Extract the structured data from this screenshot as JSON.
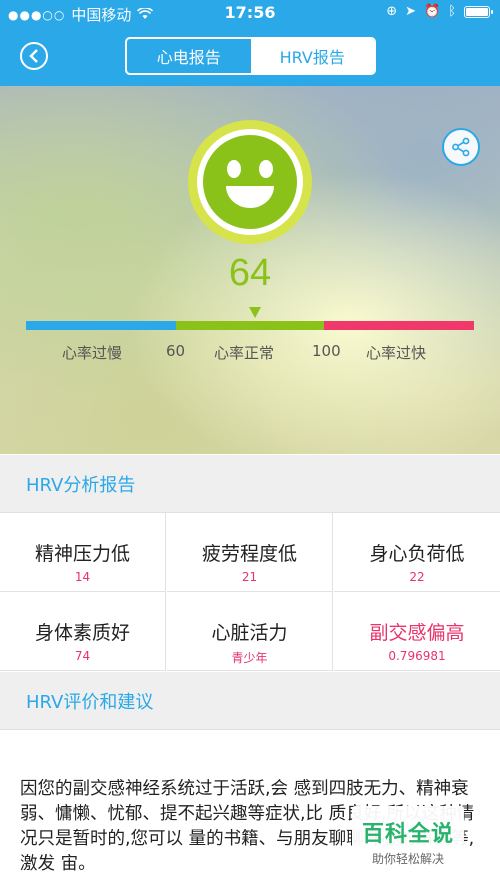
{
  "status_bar": {
    "carrier": "中国移动",
    "time": "17:56"
  },
  "nav": {
    "tabs": [
      {
        "label": "心电报告",
        "active": false
      },
      {
        "label": "HRV报告",
        "active": true
      }
    ]
  },
  "hero": {
    "score": "64",
    "range_labels": [
      "心率过慢",
      "60",
      "心率正常",
      "100",
      "心率过快"
    ],
    "colors": {
      "slow": "#2aa8e8",
      "normal": "#8bc21a",
      "fast": "#f0386a"
    }
  },
  "analysis": {
    "title": "HRV分析报告",
    "items": [
      {
        "label": "精神压力低",
        "value": "14"
      },
      {
        "label": "疲劳程度低",
        "value": "21"
      },
      {
        "label": "身心负荷低",
        "value": "22"
      },
      {
        "label": "身体素质好",
        "value": "74"
      },
      {
        "label": "心脏活力",
        "value": "青少年"
      },
      {
        "label": "副交感偏高",
        "value": "0.796981"
      }
    ]
  },
  "advice": {
    "title": "HRV评价和建议",
    "text": "因您的副交感神经系统过于活跃,会 感到四肢无力、精神衰弱、慵懒、忧郁、提不起兴趣等症状,比 质良好,所以这种情况只是暂时的,您可以 量的书籍、与朋友聊聊开心的事情等,激发 宙。"
  },
  "watermark": {
    "title": "百科全说",
    "subtitle": "助你轻松解决"
  }
}
